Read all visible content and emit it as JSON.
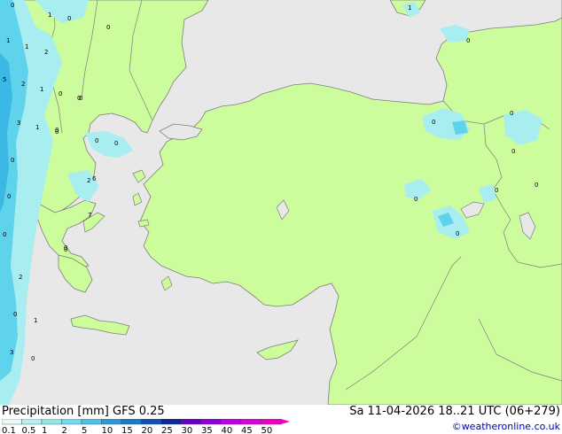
{
  "header": {
    "title": "Precipitation [mm]  GFS 0.25",
    "valid_time": "Sa 11-04-2026 18..21 UTC (06+279)",
    "credit": "©weatheronline.co.uk"
  },
  "legend": {
    "labels": [
      "0.1",
      "0.5",
      "1",
      "2",
      "5",
      "10",
      "15",
      "20",
      "25",
      "30",
      "35",
      "40",
      "45",
      "50"
    ],
    "colors": [
      "#e6fafa",
      "#b4f0f0",
      "#96e6e6",
      "#78d7f0",
      "#50bee6",
      "#3296d2",
      "#1e78c8",
      "#1450b4",
      "#0a2896",
      "#6400c8",
      "#8c00dc",
      "#be00e6",
      "#dc00dc",
      "#f000be"
    ]
  },
  "map": {
    "colors": {
      "sea": "#e8e8e8",
      "land": "#ccfc9c",
      "coast": "#7d7d7d",
      "precip_light": "#a8eef0",
      "precip_medium": "#5fd2ec",
      "precip_heavy": "#3cb8e6"
    },
    "values": [
      "0",
      "1",
      "0",
      "0",
      "1",
      "1",
      "2",
      "5",
      "2",
      "1",
      "0",
      "0",
      "3",
      "1",
      "0",
      "0",
      "0",
      "0",
      "6",
      "0",
      "7",
      "0",
      "0",
      "2",
      "0",
      "1",
      "3",
      "0",
      "1",
      "0",
      "0",
      "0",
      "0",
      "0",
      "0",
      "0",
      "0",
      "0",
      "0",
      "2",
      "0"
    ]
  }
}
